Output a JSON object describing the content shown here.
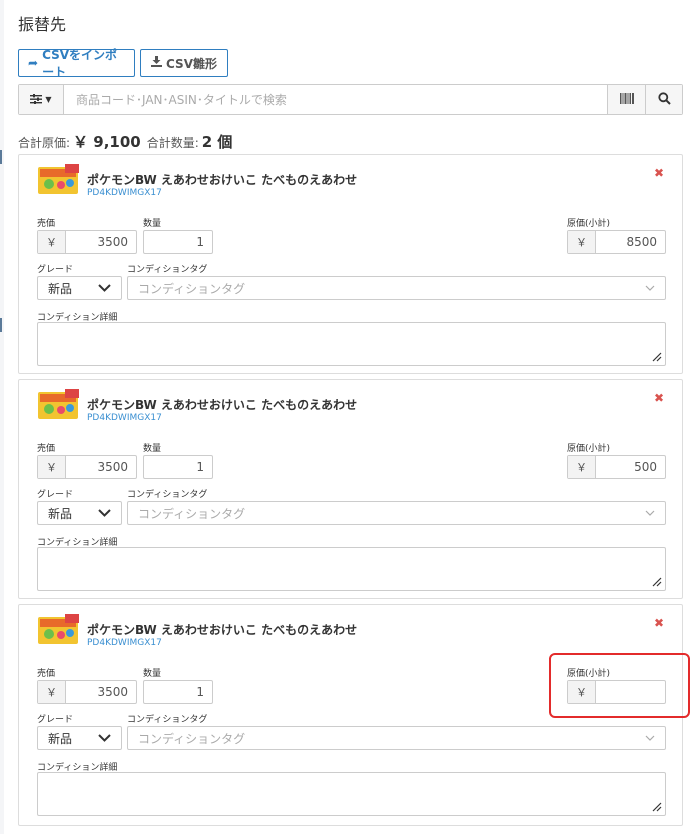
{
  "page": {
    "title": "振替先"
  },
  "toolbar": {
    "import_label": "CSVをインポート",
    "template_label": "CSV雛形"
  },
  "search": {
    "placeholder": "商品コード･JAN･ASIN･タイトルで検索"
  },
  "summary": {
    "total_cost_label": "合計原価:",
    "total_cost_value": "￥ 9,100",
    "total_qty_label": "合計数量:",
    "total_qty_value": "2 個"
  },
  "labels": {
    "price": "売価",
    "qty": "数量",
    "subtotal": "原価(小計)",
    "grade": "グレード",
    "condition_tag": "コンディションタグ",
    "condition_detail": "コンディション詳細",
    "currency": "￥",
    "remove": "✖"
  },
  "items": [
    {
      "name": "ポケモンBW えあわせおけいこ たべものえあわせ",
      "code": "PD4KDWIMGX17",
      "price": "3500",
      "qty": "1",
      "subtotal": "8500",
      "grade": "新品",
      "tag_placeholder": "コンディションタグ",
      "detail": ""
    },
    {
      "name": "ポケモンBW えあわせおけいこ たべものえあわせ",
      "code": "PD4KDWIMGX17",
      "price": "3500",
      "qty": "1",
      "subtotal": "500",
      "grade": "新品",
      "tag_placeholder": "コンディションタグ",
      "detail": ""
    },
    {
      "name": "ポケモンBW えあわせおけいこ たべものえあわせ",
      "code": "PD4KDWIMGX17",
      "price": "3500",
      "qty": "1",
      "subtotal": "",
      "grade": "新品",
      "tag_placeholder": "コンディションタグ",
      "detail": ""
    }
  ],
  "colors": {
    "accent": "#2f7ec0",
    "danger": "#d9534f",
    "highlight": "#e32b2b",
    "link": "#3a8fd1"
  }
}
